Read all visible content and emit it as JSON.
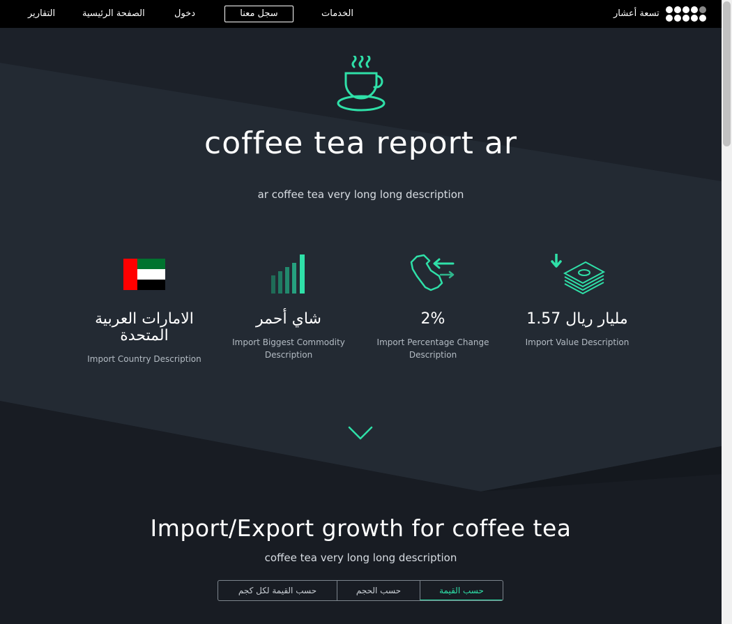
{
  "nav": {
    "reports": "التقارير",
    "home": "الصفحة الرئيسية",
    "login": "دخول",
    "register": "سجل معنا",
    "services": "الخدمات",
    "brand": "تسعة أعشار"
  },
  "hero": {
    "icon": "coffee-cup-icon",
    "title": "coffee tea report ar",
    "description": "ar coffee tea very long long description"
  },
  "stats": [
    {
      "icon": "uae-flag-icon",
      "value": "الامارات العربية المتحدة",
      "description": "Import Country Description"
    },
    {
      "icon": "bar-growth-icon",
      "value": "شاي أحمر",
      "description": "Import Biggest Commodity Description"
    },
    {
      "icon": "saudi-map-exchange-icon",
      "value": "2%",
      "description": "Import Percentage Change Description"
    },
    {
      "icon": "money-stack-icon",
      "value": "1.57 مليار ريال",
      "description": "Import Value Description"
    }
  ],
  "growth": {
    "title": "Import/Export growth for coffee tea",
    "description": "coffee tea very long long description",
    "tabs": [
      "حسب القيمة لكل كجم",
      "حسب الحجم",
      "حسب القيمة"
    ],
    "active_tab": "حسب القيمة"
  },
  "colors": {
    "accent": "#2fe0a8",
    "background": "#1b2028",
    "navbar": "#000000"
  }
}
